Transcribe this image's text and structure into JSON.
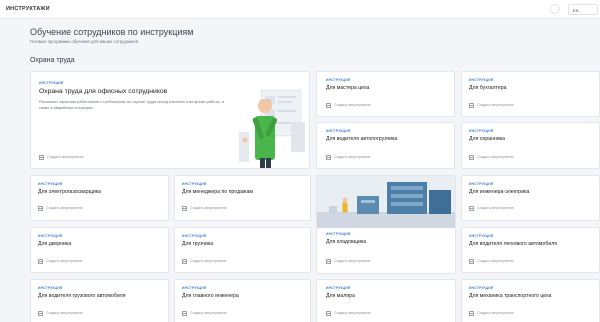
{
  "app": {
    "title": "ИНСТРУКТАЖИ",
    "lang": "EN"
  },
  "page": {
    "title": "Обучение сотрудников по инструкциям",
    "subtitle": "Готовые программы обучения для ваших сотрудников"
  },
  "section": {
    "title": "Охрана труда"
  },
  "tag_label": "ИНСТРУКЦИЯ",
  "create_label": "Создать мероприятие",
  "featured": {
    "title": "Охрана труда для офисных сотрудников",
    "description": "Расскажет офисным работникам о требованиях по охране труда перед началом и во время работы, а также в аварийных ситуациях"
  },
  "cards": {
    "c1": "Для мастера цеха",
    "c2": "Для бухгалтера",
    "c3": "Для водителя автопогрузчика",
    "c4": "Для охранника",
    "c5": "Для электрогазосварщика",
    "c6": "Для менеджера по продажам",
    "c7": "Для инженера-электрика",
    "c8": "Для дворника",
    "c9": "Для грузчика",
    "c10": "Для кладовщика",
    "c11": "Для водителя легкового автомобиля",
    "c12": "Для водителя грузового автомобиля",
    "c13": "Для главного инженера",
    "c14": "Для маляра",
    "c15": "Для механика транспортного цеха"
  }
}
